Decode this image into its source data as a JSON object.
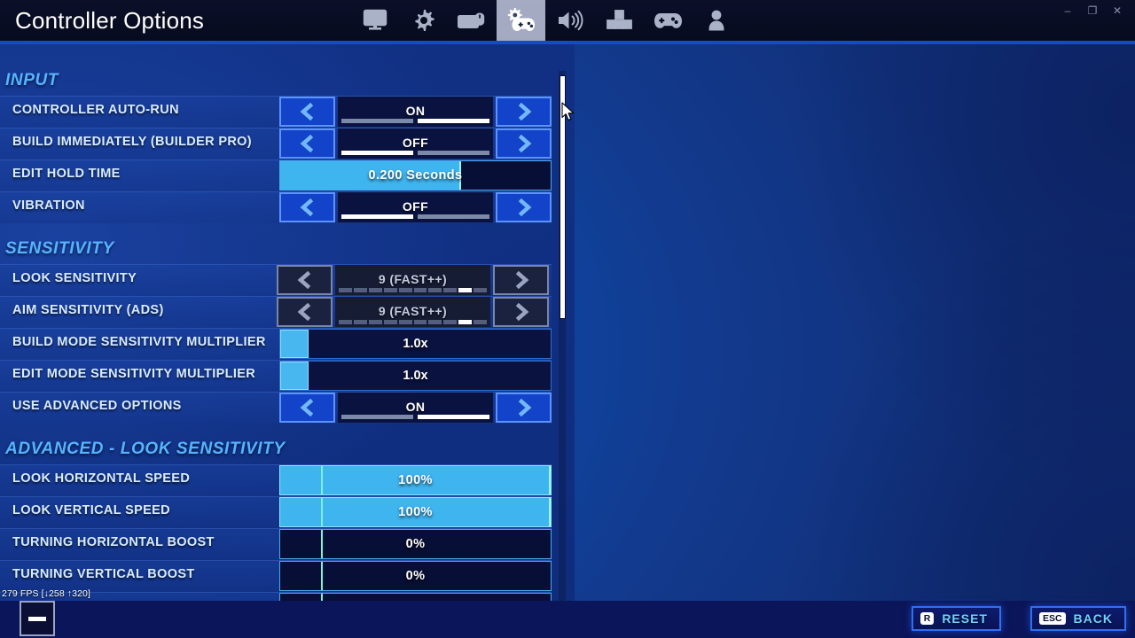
{
  "window": {
    "title": "Controller Options",
    "controls": [
      {
        "name": "minimize",
        "glyph": "–"
      },
      {
        "name": "maximize",
        "glyph": "❐"
      },
      {
        "name": "close",
        "glyph": "✕"
      }
    ]
  },
  "tabs": [
    {
      "id": "video",
      "icon": "monitor-icon",
      "active": false
    },
    {
      "id": "game",
      "icon": "gear-icon",
      "active": false
    },
    {
      "id": "kbm",
      "icon": "keyboard-mouse-icon",
      "active": false
    },
    {
      "id": "controller",
      "icon": "controller-gear-icon",
      "active": true
    },
    {
      "id": "audio",
      "icon": "speaker-icon",
      "active": false
    },
    {
      "id": "keybinds",
      "icon": "dpad-keys-icon",
      "active": false
    },
    {
      "id": "gamepad",
      "icon": "gamepad-icon",
      "active": false
    },
    {
      "id": "account",
      "icon": "account-person-icon",
      "active": false
    }
  ],
  "sections": [
    {
      "id": "input",
      "title": "INPUT",
      "rows": [
        {
          "label": "CONTROLLER AUTO-RUN",
          "type": "toggle",
          "value": "ON",
          "state": "on",
          "disabled": false
        },
        {
          "label": "BUILD IMMEDIATELY (BUILDER PRO)",
          "type": "toggle",
          "value": "OFF",
          "state": "off",
          "disabled": false
        },
        {
          "label": "EDIT HOLD TIME",
          "type": "slider",
          "value": "0.200 Seconds",
          "fill_pct": 67,
          "mark_pct": 67,
          "style": "partial"
        },
        {
          "label": "VIBRATION",
          "type": "toggle",
          "value": "OFF",
          "state": "off",
          "disabled": false
        }
      ]
    },
    {
      "id": "sensitivity",
      "title": "SENSITIVITY",
      "rows": [
        {
          "label": "LOOK SENSITIVITY",
          "type": "ticks",
          "value": "9 (FAST++)",
          "ticks": 10,
          "active_tick": 9,
          "disabled": true
        },
        {
          "label": "AIM SENSITIVITY (ADS)",
          "type": "ticks",
          "value": "9 (FAST++)",
          "ticks": 10,
          "active_tick": 9,
          "disabled": true
        },
        {
          "label": "BUILD MODE SENSITIVITY MULTIPLIER",
          "type": "multiplier",
          "value": "1.0x",
          "fill_pct": 10
        },
        {
          "label": "EDIT MODE SENSITIVITY MULTIPLIER",
          "type": "multiplier",
          "value": "1.0x",
          "fill_pct": 10
        },
        {
          "label": "USE ADVANCED OPTIONS",
          "type": "toggle",
          "value": "ON",
          "state": "on",
          "disabled": false
        }
      ]
    },
    {
      "id": "advanced-look",
      "title": "ADVANCED - LOOK SENSITIVITY",
      "rows": [
        {
          "label": "LOOK HORIZONTAL SPEED",
          "type": "slider",
          "value": "100%",
          "fill_pct": 100,
          "mark_pct": 15,
          "style": "full"
        },
        {
          "label": "LOOK VERTICAL SPEED",
          "type": "slider",
          "value": "100%",
          "fill_pct": 100,
          "mark_pct": 15,
          "style": "full"
        },
        {
          "label": "TURNING HORIZONTAL BOOST",
          "type": "slider",
          "value": "0%",
          "fill_pct": 0,
          "mark_pct": 15,
          "style": "empty"
        },
        {
          "label": "TURNING VERTICAL BOOST",
          "type": "slider",
          "value": "0%",
          "fill_pct": 0,
          "mark_pct": 15,
          "style": "empty"
        }
      ]
    }
  ],
  "overlay": {
    "fps_text": "279 FPS [↓258 ↑320]"
  },
  "footer": {
    "reset": {
      "key": "R",
      "label": "RESET"
    },
    "back": {
      "key": "ESC",
      "label": "BACK"
    }
  },
  "colors": {
    "accent_cyan": "#3fb5f0",
    "section_title": "#56b4ff",
    "arrow_blue": "#73b8ff",
    "panel_blue": "#113084",
    "nav_label": "#6fd2ff"
  }
}
